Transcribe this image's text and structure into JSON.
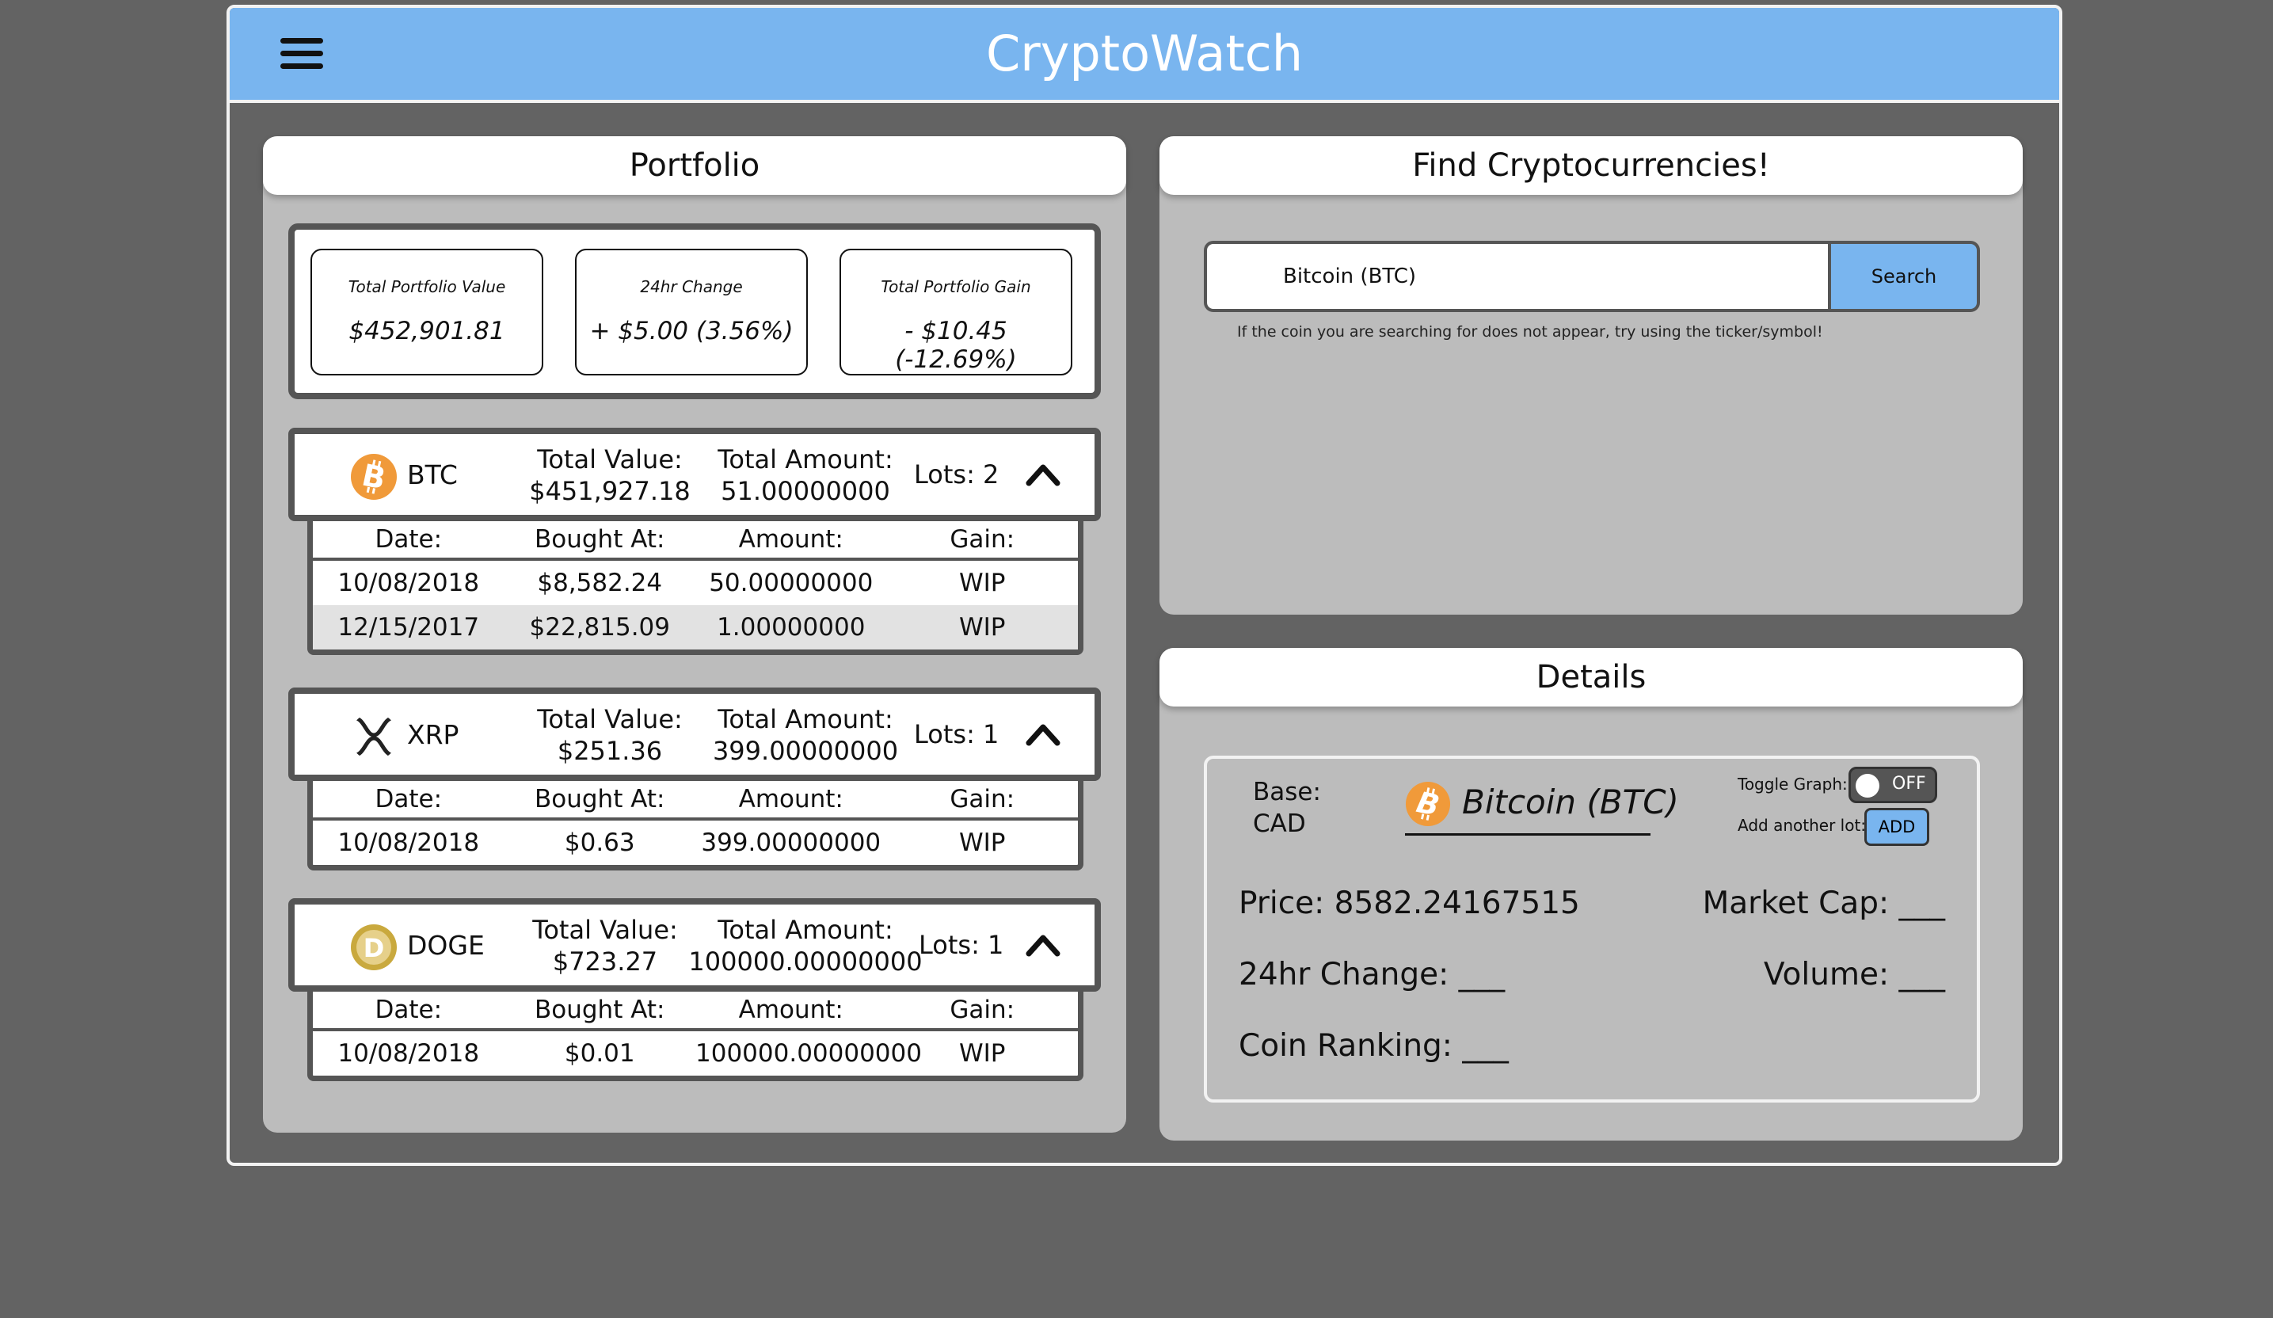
{
  "header": {
    "title": "CryptoWatch",
    "menu_icon": "hamburger-menu-icon",
    "bg_color": "#79b5ef"
  },
  "portfolio": {
    "heading": "Portfolio",
    "summary": [
      {
        "label": "Total Portfolio Value",
        "value": "$452,901.81"
      },
      {
        "label": "24hr Change",
        "value": "+ $5.00 (3.56%)"
      },
      {
        "label": "Total Portfolio Gain",
        "value": "- $10.45 (-12.69%)"
      }
    ],
    "coins": [
      {
        "symbol": "BTC",
        "icon": "bitcoin-icon",
        "total_value_label": "Total Value:",
        "total_value": "$451,927.18",
        "total_amount_label": "Total Amount:",
        "total_amount": "51.00000000",
        "lots": "Lots: 2",
        "columns": [
          "Date:",
          "Bought At:",
          "Amount:",
          "Gain:"
        ],
        "rows": [
          [
            "10/08/2018",
            "$8,582.24",
            "50.00000000",
            "WIP"
          ],
          [
            "12/15/2017",
            "$22,815.09",
            "1.00000000",
            "WIP"
          ]
        ]
      },
      {
        "symbol": "XRP",
        "icon": "ripple-icon",
        "total_value_label": "Total Value:",
        "total_value": "$251.36",
        "total_amount_label": "Total Amount:",
        "total_amount": "399.00000000",
        "lots": "Lots: 1",
        "columns": [
          "Date:",
          "Bought At:",
          "Amount:",
          "Gain:"
        ],
        "rows": [
          [
            "10/08/2018",
            "$0.63",
            "399.00000000",
            "WIP"
          ]
        ]
      },
      {
        "symbol": "DOGE",
        "icon": "dogecoin-icon",
        "total_value_label": "Total Value:",
        "total_value": "$723.27",
        "total_amount_label": "Total Amount:",
        "total_amount": "100000.00000000",
        "lots": "Lots: 1",
        "columns": [
          "Date:",
          "Bought At:",
          "Amount:",
          "Gain:"
        ],
        "rows": [
          [
            "10/08/2018",
            "$0.01",
            "100000.00000000",
            "WIP"
          ]
        ]
      }
    ]
  },
  "finder": {
    "heading": "Find Cryptocurrencies!",
    "search_value": "Bitcoin (BTC)",
    "search_button": "Search",
    "hint": "If the coin you are searching for does not appear, try using the ticker/symbol!"
  },
  "details": {
    "heading": "Details",
    "base_label": "Base:",
    "base_value": "CAD",
    "coin_name": "Bitcoin (BTC)",
    "toggle_label": "Toggle Graph:",
    "toggle_state": "OFF",
    "add_lot_label": "Add another lot:",
    "add_button": "ADD",
    "price": "Price: 8582.24167515",
    "market_cap": "Market Cap: ___",
    "change": "24hr Change: ___",
    "volume": "Volume: ___",
    "ranking": "Coin Ranking: ___"
  }
}
